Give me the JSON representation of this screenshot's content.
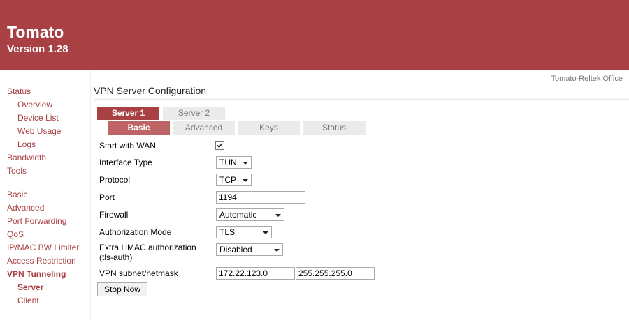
{
  "header": {
    "title": "Tomato",
    "version": "Version 1.28",
    "router_name": "Tomato-Reltek Office"
  },
  "sidebar": {
    "items": [
      {
        "label": "Status"
      },
      {
        "label": "Overview"
      },
      {
        "label": "Device List"
      },
      {
        "label": "Web Usage"
      },
      {
        "label": "Logs"
      },
      {
        "label": "Bandwidth"
      },
      {
        "label": "Tools"
      },
      {
        "label": "Basic"
      },
      {
        "label": "Advanced"
      },
      {
        "label": "Port Forwarding"
      },
      {
        "label": "QoS"
      },
      {
        "label": "IP/MAC BW Limiter"
      },
      {
        "label": "Access Restriction"
      },
      {
        "label": "VPN Tunneling"
      },
      {
        "label": "Server"
      },
      {
        "label": "Client"
      }
    ]
  },
  "main": {
    "title": "VPN Server Configuration",
    "server_tabs": [
      {
        "label": "Server 1"
      },
      {
        "label": "Server 2"
      }
    ],
    "sub_tabs": [
      {
        "label": "Basic"
      },
      {
        "label": "Advanced"
      },
      {
        "label": "Keys"
      },
      {
        "label": "Status"
      }
    ],
    "form": {
      "start_wan": {
        "label": "Start with WAN",
        "checked": true
      },
      "interface_type": {
        "label": "Interface Type",
        "value": "TUN"
      },
      "protocol": {
        "label": "Protocol",
        "value": "TCP"
      },
      "port": {
        "label": "Port",
        "value": "1194"
      },
      "firewall": {
        "label": "Firewall",
        "value": "Automatic"
      },
      "auth_mode": {
        "label": "Authorization Mode",
        "value": "TLS"
      },
      "hmac": {
        "label_line1": "Extra HMAC authorization",
        "label_line2": "(tls-auth)",
        "value": "Disabled"
      },
      "subnet": {
        "label": "VPN subnet/netmask",
        "subnet_value": "172.22.123.0",
        "netmask_value": "255.255.255.0"
      }
    },
    "stop_button": "Stop Now"
  },
  "colors": {
    "brand": "#a94043",
    "tab_active": "#a94043",
    "subtab_active": "#bf6466",
    "tab_inactive": "#ebebeb",
    "link": "#a94043"
  }
}
